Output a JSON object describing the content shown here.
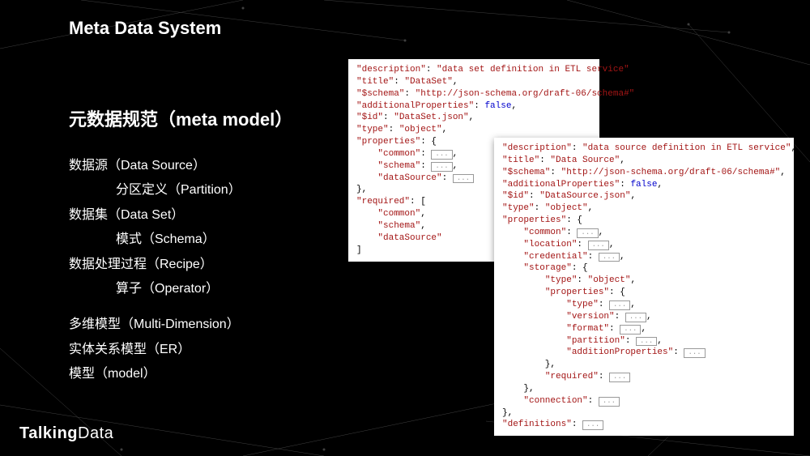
{
  "title": "Meta Data System",
  "heading": "元数据规范（meta model）",
  "items": [
    {
      "text": "数据源（Data Source）",
      "sub": false
    },
    {
      "text": "分区定义（Partition）",
      "sub": true
    },
    {
      "text": "数据集（Data Set）",
      "sub": false
    },
    {
      "text": "模式（Schema）",
      "sub": true
    },
    {
      "text": "数据处理过程（Recipe）",
      "sub": false
    },
    {
      "text": "算子（Operator）",
      "sub": true
    }
  ],
  "items2": [
    {
      "text": "多维模型（Multi-Dimension）",
      "sub": false
    },
    {
      "text": "实体关系模型（ER）",
      "sub": false
    },
    {
      "text": "模型（model）",
      "sub": false
    }
  ],
  "codeLeft": {
    "description": "data set definition in ETL service",
    "title2": "DataSet",
    "schema": "http://json-schema.org/draft-06/schema#",
    "additionalProperties": "false",
    "id": "DataSet.json",
    "type": "object",
    "props": [
      "common",
      "schema",
      "dataSource"
    ],
    "required": [
      "common",
      "schema",
      "dataSource"
    ]
  },
  "codeRight": {
    "description": "data source definition in ETL service",
    "title2": "Data Source",
    "schema": "http://json-schema.org/draft-06/schema#",
    "additionalProperties": "false",
    "id": "DataSource.json",
    "type": "object",
    "topProps": [
      "common",
      "location",
      "credential"
    ],
    "storageType": "object",
    "storageProps": [
      "type",
      "version",
      "format",
      "partition",
      "additionProperties"
    ],
    "storageRequired": "required",
    "connection": "connection",
    "definitions": "definitions"
  },
  "logo": {
    "a": "Talking",
    "b": "Data"
  }
}
